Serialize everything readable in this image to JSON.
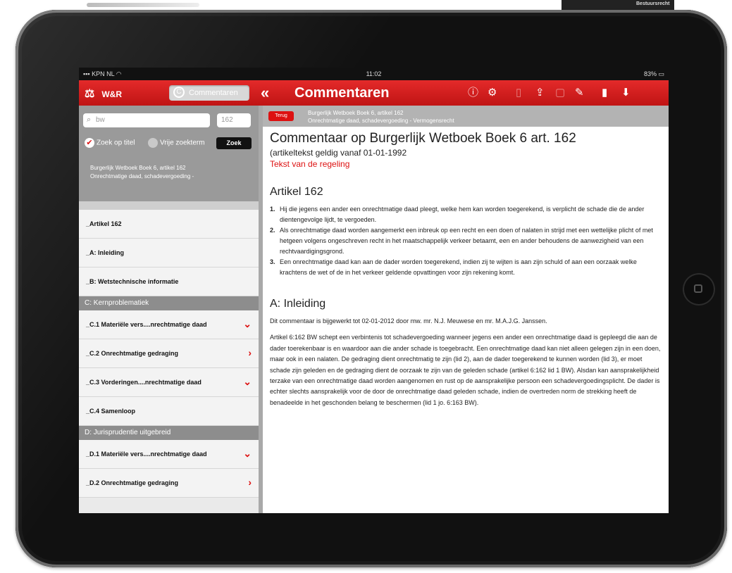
{
  "device_corner_label": "Bestuursrecht",
  "status_bar": {
    "carrier": "KPN NL",
    "time": "11:02",
    "battery": "83%"
  },
  "nav": {
    "ww_label": "W&R",
    "comm_tab_label": "Commentaren",
    "back_glyph": "«",
    "title": "Commentaren",
    "icons": [
      "info-icon",
      "gear-icon",
      "bookmark-disabled-icon",
      "share-icon",
      "copy-icon",
      "edit-icon",
      "bookmark-icon",
      "download-icon"
    ]
  },
  "sidebar": {
    "search_value": "bw",
    "article_number": "162",
    "zoek_op_titel": "Zoek op titel",
    "vrije_zoekterm": "Vrije zoekterm",
    "zoek_button": "Zoek",
    "selected_line1": "Burgerlijk Wetboek Boek 6, artikel 162",
    "selected_line2": "Onrechtmatige daad, schadevergoeding -",
    "items_a": [
      {
        "label": "_Artikel 162"
      },
      {
        "label": "_A: Inleiding"
      },
      {
        "label": "_B: Wetstechnische informatie"
      }
    ],
    "section_c": "C: Kernproblematiek",
    "items_c": [
      {
        "label": "_C.1 Materiële vers....nrechtmatige daad",
        "arrow": "⌄"
      },
      {
        "label": "_C.2 Onrechtmatige gedraging",
        "arrow": "›"
      },
      {
        "label": "_C.3 Vorderingen....nrechtmatige daad",
        "arrow": "⌄"
      },
      {
        "label": "_C.4 Samenloop",
        "arrow": ""
      }
    ],
    "section_d": "D: Jurisprudentie uitgebreid",
    "items_d": [
      {
        "label": "_D.1 Materiële vers....nrechtmatige daad",
        "arrow": "⌄"
      },
      {
        "label": "_D.2 Onrechtmatige gedraging",
        "arrow": "›"
      }
    ]
  },
  "content": {
    "terug": "Terug",
    "breadcrumb_line1": "Burgerlijk Wetboek Boek 6, artikel 162",
    "breadcrumb_line2": "Onrechtmatige daad, schadevergoeding - Vermogensrecht",
    "title": "Commentaar op Burgerlijk Wetboek Boek 6 art. 162",
    "subtitle": "(artikeltekst geldig vanaf 01-01-1992",
    "regeling_link": "Tekst van de regeling",
    "artikel_heading": "Artikel 162",
    "artikel_items": [
      {
        "n": "1.",
        "text": "Hij die jegens een ander een onrechtmatige daad pleegt, welke hem kan worden toegerekend, is verplicht de schade die de ander dientengevolge lijdt, te vergoeden."
      },
      {
        "n": "2.",
        "text": "Als onrechtmatige daad worden aangemerkt een inbreuk op een recht en een doen of nalaten in strijd met een wettelijke plicht of met hetgeen volgens ongeschreven recht in het maatschappelijk verkeer betaamt, een en ander behoudens de aanwezigheid van een rechtvaardigingsgrond."
      },
      {
        "n": "3.",
        "text": "Een onrechtmatige daad kan aan de dader worden toegerekend, indien zij te wijten is aan zijn schuld of aan een oorzaak welke krachtens de wet of de in het verkeer geldende opvattingen voor zijn rekening komt."
      }
    ],
    "inleiding_heading": "A: Inleiding",
    "inleiding_p1": "Dit commentaar is bijgewerkt tot 02-01-2012 door mw. mr. N.J. Meuwese en mr. M.A.J.G. Janssen.",
    "inleiding_p2": "Artikel 6:162 BW schept een verbintenis tot schadevergoeding wanneer jegens een ander een onrechtmatige daad is gepleegd die aan de dader toerekenbaar is en waardoor aan die ander schade is toegebracht. Een onrechtmatige daad kan niet alleen gelegen zijn in een doen, maar ook in een nalaten. De gedraging dient onrechtmatig te zijn (lid 2), aan de dader toegerekend te kunnen worden (lid 3), er moet schade zijn geleden en de gedraging dient de oorzaak te zijn van de geleden schade (artikel 6:162 lid 1 BW). Alsdan kan aansprakelijkheid terzake van een onrechtmatige daad worden aangenomen en rust op de aansprakelijke persoon een schadevergoedingsplicht. De dader is echter slechts aansprakelijk voor de door de onrechtmatige daad geleden schade, indien de overtreden norm de strekking heeft de benadeelde in het geschonden belang te beschermen (lid 1 jo. 6:163 BW)."
  },
  "colors": {
    "accent": "#d11a1a",
    "nav_red": "#c91919",
    "sidebar_grey": "#9a9a9a"
  }
}
